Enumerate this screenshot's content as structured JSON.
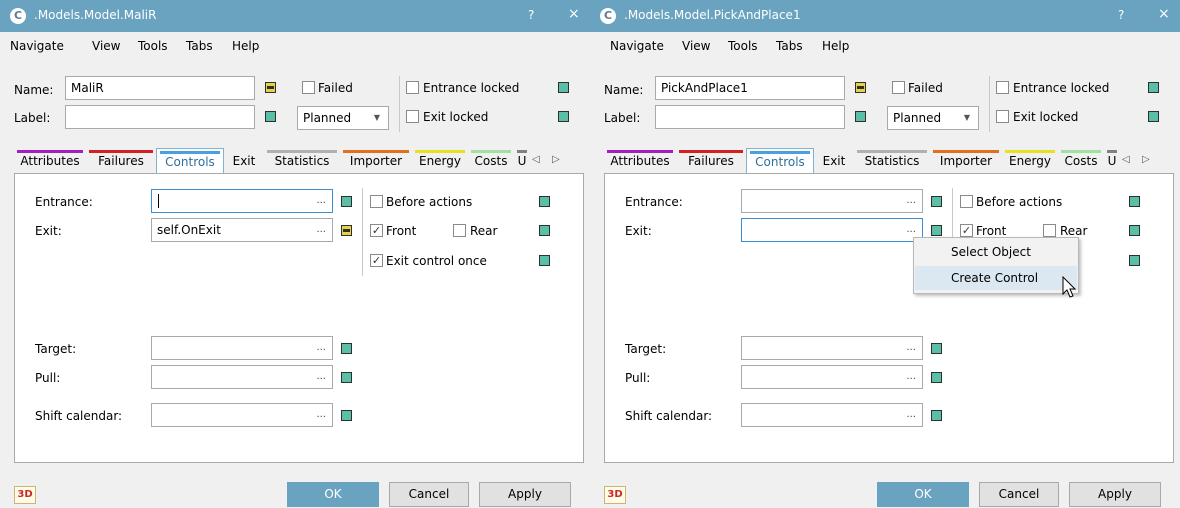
{
  "colors": {
    "titlebar": "#6aa3bf",
    "ok_button": "#6aa3bf",
    "indicator_green": "#5bbfa8",
    "indicator_yellow": "#e6d24a",
    "active_tab": "#2e6f9e"
  },
  "menu": [
    "Navigate",
    "View",
    "Tools",
    "Tabs",
    "Help"
  ],
  "common": {
    "title_help": "?",
    "title_close": "×",
    "name_label": "Name:",
    "label_label": "Label:",
    "failed": "Failed",
    "planned": "Planned",
    "entrance_locked": "Entrance locked",
    "exit_locked": "Exit locked",
    "entrance": "Entrance:",
    "exit": "Exit:",
    "target": "Target:",
    "pull": "Pull:",
    "shift_calendar": "Shift calendar:",
    "before_actions": "Before actions",
    "front": "Front",
    "rear": "Rear",
    "exit_control_once": "Exit control once",
    "ellipsis": "...",
    "ok": "OK",
    "cancel": "Cancel",
    "apply": "Apply",
    "logo_3d": "3D",
    "tab_scroll_left": "◁",
    "tab_scroll_right": "▷",
    "check": "✓",
    "combo_arrow": "▼"
  },
  "tabs": [
    {
      "label": "Attributes",
      "color": "#a020c0"
    },
    {
      "label": "Failures",
      "color": "#d42020"
    },
    {
      "label": "Controls",
      "color": "#4aa0e0"
    },
    {
      "label": "Exit",
      "color": ""
    },
    {
      "label": "Statistics",
      "color": "#b0b0b0"
    },
    {
      "label": "Importer",
      "color": "#e07020"
    },
    {
      "label": "Energy",
      "color": "#e8e020"
    },
    {
      "label": "Costs",
      "color": "#a0e0a0"
    },
    {
      "label": "U",
      "color": "#808080"
    }
  ],
  "left": {
    "title": ".Models.Model.MaliR",
    "name_value": "MaliR",
    "label_value": "",
    "entrance_value": "",
    "exit_value": "self.OnExit",
    "front_checked": true,
    "exit_control_once_checked": true
  },
  "right": {
    "title": ".Models.Model.PickAndPlace1",
    "name_value": "PickAndPlace1",
    "label_value": "",
    "entrance_value": "",
    "exit_value": "",
    "front_checked": true
  },
  "context_menu": [
    "Select Object",
    "Create Control"
  ]
}
